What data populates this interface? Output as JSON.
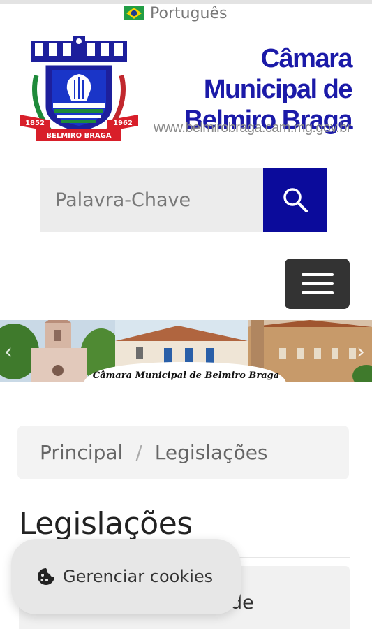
{
  "language": {
    "label": "Português",
    "flag_icon": "brazil-flag-icon"
  },
  "logo": {
    "title_line1": "Câmara Municipal de",
    "title_line2": "Belmiro Braga",
    "url": "www.belmirobraga.cam.mg.gov.br",
    "crest_left_year": "1852",
    "crest_right_year": "1962",
    "crest_ribbon": "BELMIRO BRAGA",
    "brand_color": "#1b1aa8"
  },
  "search": {
    "placeholder": "Palavra-Chave",
    "button_icon": "search-icon",
    "button_color": "#0b0b9b"
  },
  "menu": {
    "icon": "hamburger-menu-icon"
  },
  "banner": {
    "caption": "Câmara Municipal de Belmiro Braga",
    "prev_icon": "chevron-left-icon",
    "next_icon": "chevron-right-icon"
  },
  "breadcrumb": {
    "items": [
      "Principal",
      "Legislações"
    ],
    "separator": "/"
  },
  "page": {
    "title": "Legislações"
  },
  "card": {
    "text_fragment": "de"
  },
  "cookie": {
    "label": "Gerenciar cookies",
    "icon": "cookie-icon"
  }
}
